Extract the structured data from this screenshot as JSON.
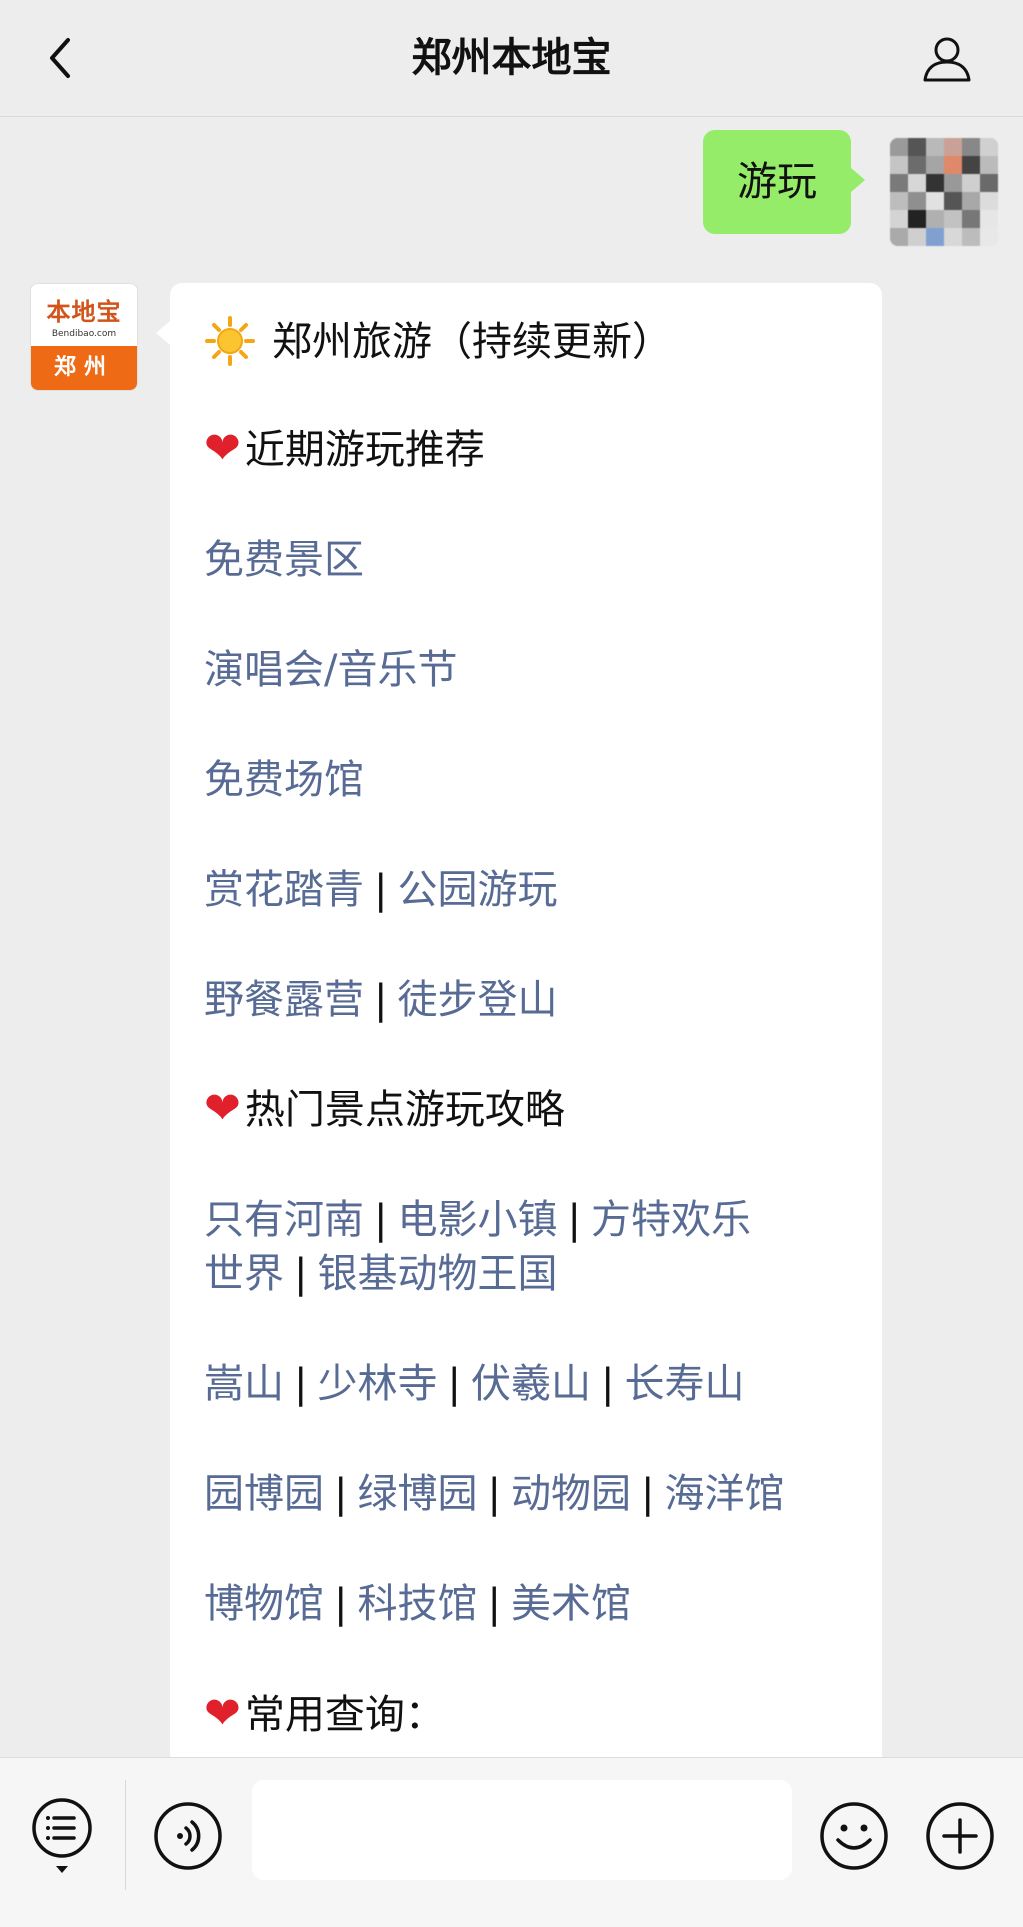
{
  "header": {
    "title": "郑州本地宝",
    "back_icon": "chevron-left-icon",
    "profile_icon": "person-icon"
  },
  "sent_message": {
    "text": "游玩"
  },
  "bot": {
    "avatar": {
      "logo_name": "本地宝",
      "logo_url": "Bendibao.com",
      "city": "郑州"
    },
    "lines": {
      "title": "郑州旅游（持续更新）",
      "recent_heading": "近期游玩推荐",
      "free_scenic": "免费景区",
      "concert_festival": "演唱会/音乐节",
      "free_venues": "免费场馆",
      "flowers": "赏花踏青",
      "parks": "公园游玩",
      "picnic": "野餐露营",
      "hiking": "徒步登山",
      "hot_heading": "热门景点游玩攻略",
      "only_henan": "只有河南",
      "film_town": "电影小镇",
      "fantawild_1": "方特欢乐",
      "fantawild_2": "世界",
      "yinji": "银基动物王国",
      "songshan": "嵩山",
      "shaolin": "少林寺",
      "fuxi": "伏羲山",
      "changshou": "长寿山",
      "yuanbo": "园博园",
      "lvbo": "绿博园",
      "zoo": "动物园",
      "aquarium": "海洋馆",
      "museum": "博物馆",
      "science": "科技馆",
      "art": "美术馆",
      "query_heading": "常用查询："
    },
    "separator": "|",
    "heart_glyph": "❤"
  },
  "input_bar": {
    "menu_icon": "menu-list-icon",
    "voice_icon": "voice-icon",
    "emoji_icon": "emoji-icon",
    "plus_icon": "plus-icon",
    "input_value": ""
  },
  "colors": {
    "background": "#ededed",
    "sent_bubble": "#95ec69",
    "link": "#576b95",
    "heart": "#e0202a",
    "brand_orange": "#ee6a14"
  }
}
